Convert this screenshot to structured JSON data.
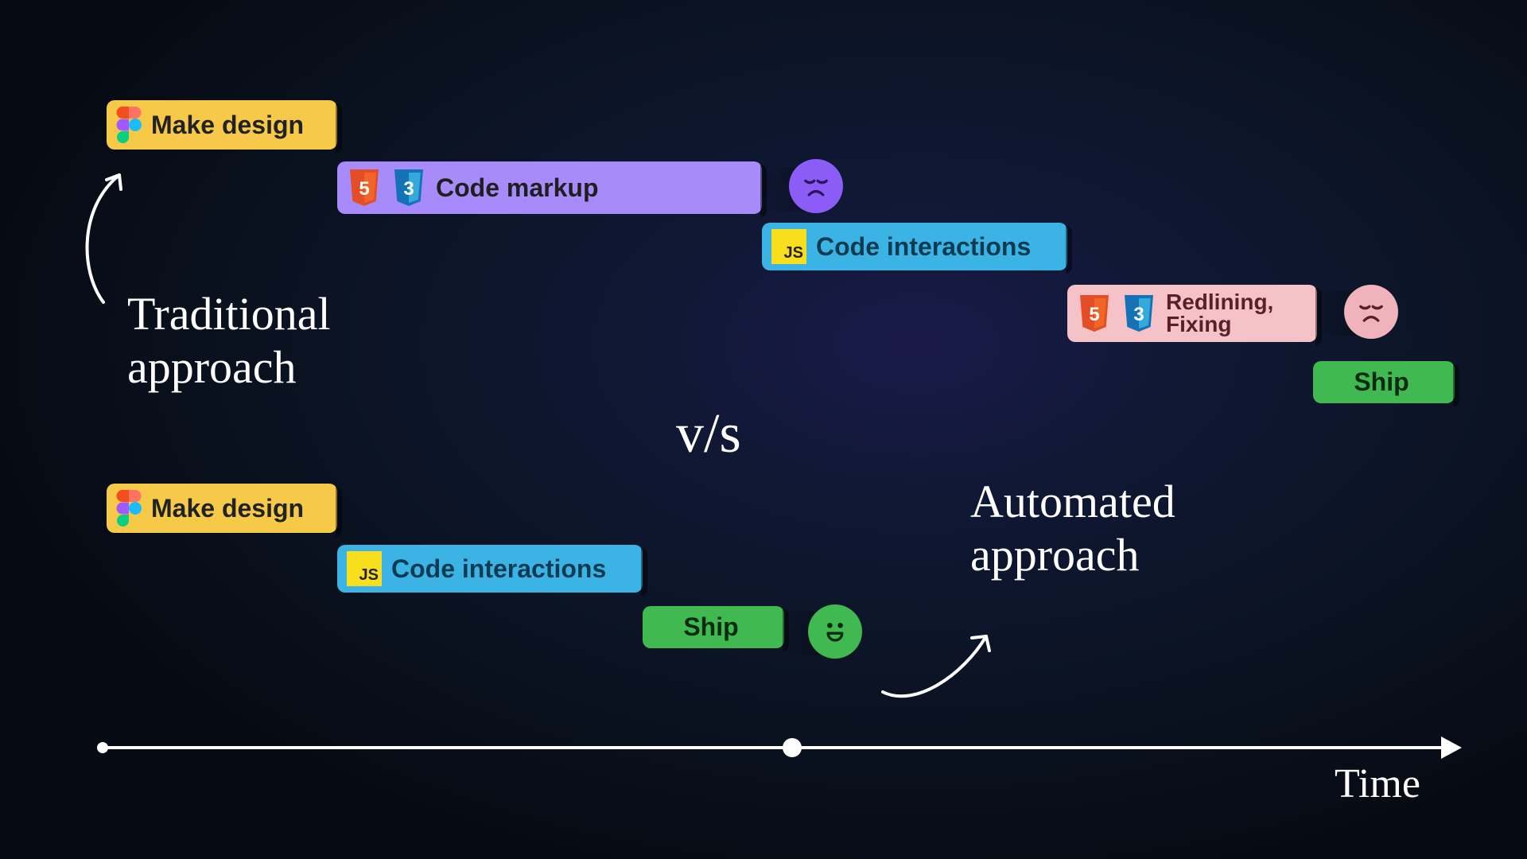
{
  "labels": {
    "traditional_title": "Traditional\napproach",
    "automated_title": "Automated\napproach",
    "versus": "v/s",
    "time_axis": "Time"
  },
  "traditional": {
    "make_design": "Make design",
    "code_markup": "Code markup",
    "code_interactions": "Code interactions",
    "redlining_line1": "Redlining,",
    "redlining_line2": "Fixing",
    "ship": "Ship"
  },
  "automated": {
    "make_design": "Make design",
    "code_interactions": "Code interactions",
    "ship": "Ship"
  },
  "icons": {
    "html5_letter": "5",
    "css3_letter": "3",
    "js_letters": "JS"
  }
}
